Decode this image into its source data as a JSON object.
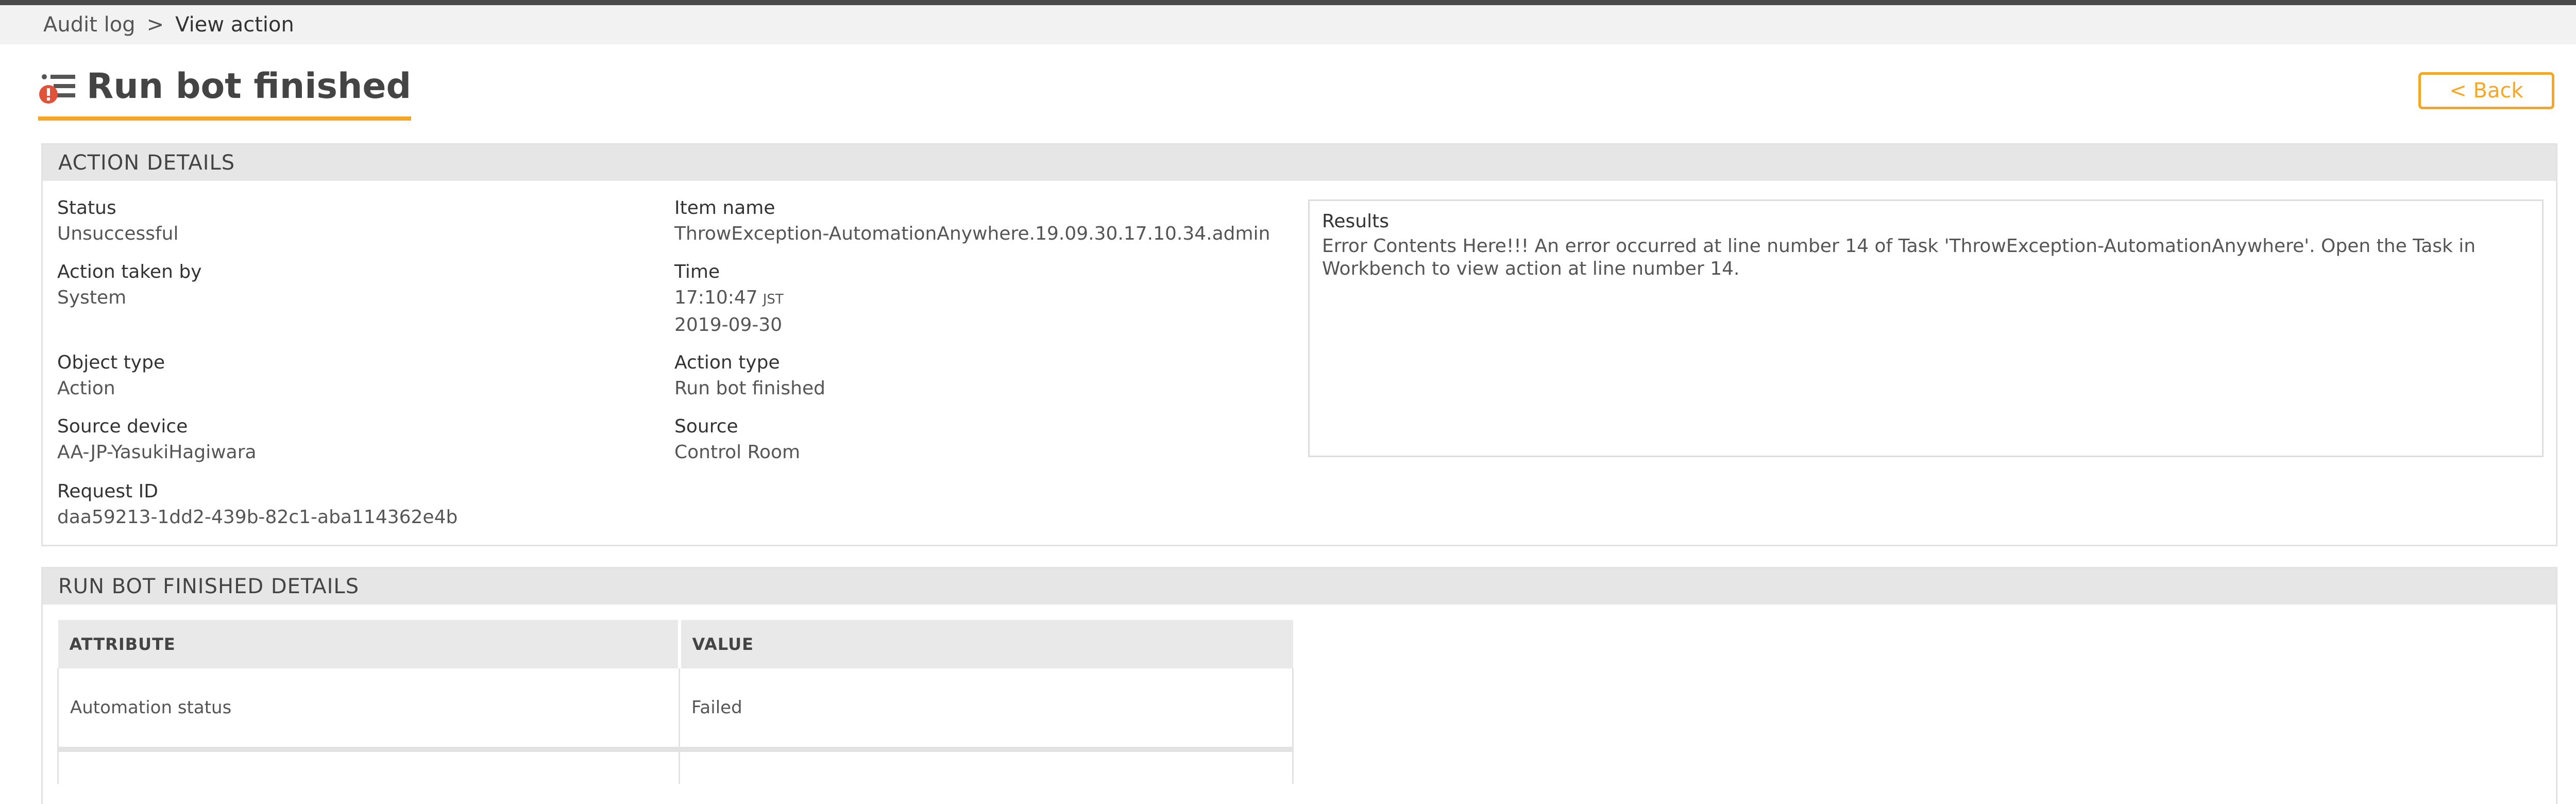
{
  "breadcrumb": {
    "parent": "Audit log",
    "separator": ">",
    "current": "View action"
  },
  "header": {
    "title": "Run bot finished",
    "back_label": "< Back",
    "icon": "error-list-icon"
  },
  "action_details": {
    "heading": "ACTION DETAILS",
    "fields": {
      "status": {
        "label": "Status",
        "value": "Unsuccessful"
      },
      "action_taken_by": {
        "label": "Action taken by",
        "value": "System"
      },
      "object_type": {
        "label": "Object type",
        "value": "Action"
      },
      "source_device": {
        "label": "Source device",
        "value": "AA-JP-YasukiHagiwara"
      },
      "request_id": {
        "label": "Request ID",
        "value": "daa59213-1dd2-439b-82c1-aba114362e4b"
      },
      "item_name": {
        "label": "Item name",
        "value": "ThrowException-AutomationAnywhere.19.09.30.17.10.34.admin"
      },
      "time": {
        "label": "Time",
        "value": "17:10:47",
        "zone": "JST",
        "date": "2019-09-30"
      },
      "action_type": {
        "label": "Action type",
        "value": "Run bot finished"
      },
      "source": {
        "label": "Source",
        "value": "Control Room"
      }
    },
    "results": {
      "label": "Results",
      "value": "Error Contents Here!!! An error occurred at line number 14 of Task 'ThrowException-AutomationAnywhere'. Open the Task in Workbench to view action at line number 14."
    }
  },
  "run_bot_details": {
    "heading": "RUN BOT FINISHED DETAILS",
    "columns": [
      "ATTRIBUTE",
      "VALUE"
    ],
    "rows": [
      {
        "attribute": "Automation status",
        "value": "Failed"
      }
    ]
  },
  "colors": {
    "accent": "#f5a623",
    "error": "#e0533a",
    "header_bg": "#e6e6e6"
  }
}
